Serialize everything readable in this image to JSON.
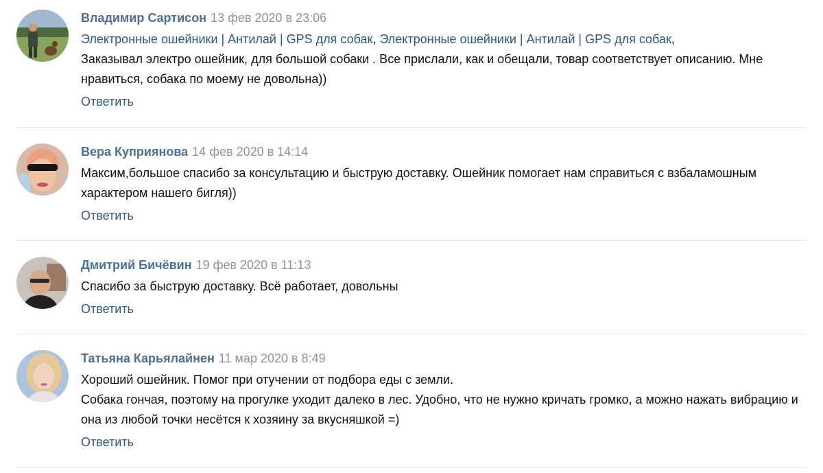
{
  "comments": [
    {
      "author": "Владимир Сартисон",
      "date": "13 фев 2020 в 23:06",
      "links": [
        "Электронные ошейники | Антилай | GPS для собак",
        "Электронные ошейники | Антилай | GPS для собак"
      ],
      "text": "Заказывал электро ошейник, для большой собаки . Все прислали, как и обещали, товар соответствует описанию. Мне нравиться, собака по моему не довольна))",
      "reply": "Ответить"
    },
    {
      "author": "Вера Куприянова",
      "date": "14 фев 2020 в 14:14",
      "text": "Максим,большое спасибо за консультацию и быструю доставку. Ошейник помогает нам справиться с взбаламошным характером нашего бигля))",
      "reply": "Ответить"
    },
    {
      "author": "Дмитрий Бичёвин",
      "date": "19 фев 2020 в 11:13",
      "text": "Спасибо за быструю доставку. Всё работает, довольны",
      "reply": "Ответить"
    },
    {
      "author": "Татьяна Карьялайнен",
      "date": "11 мар 2020 в 8:49",
      "text_line1": "Хороший ошейник. Помог при отучении от подбора еды с земли.",
      "text_line2": "Собака гончая, поэтому на прогулке уходит далеко в лес. Удобно, что не нужно кричать громко, а можно нажать вибрацию и она из любой точки несётся к хозяину за вкусняшкой =)",
      "reply": "Ответить"
    }
  ],
  "separators": {
    "comma": ","
  },
  "colors": {
    "author": "#4a6f9b",
    "link": "#2a5885",
    "date": "#8c939b",
    "divider": "#e3e6ea"
  }
}
